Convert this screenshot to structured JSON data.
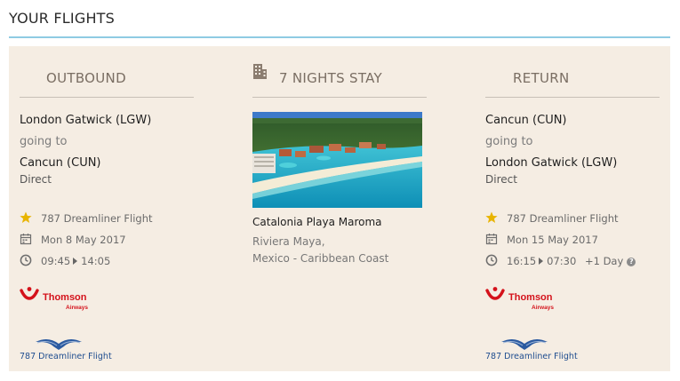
{
  "page": {
    "title": "YOUR FLIGHTS"
  },
  "outbound": {
    "heading": "OUTBOUND",
    "from": "London Gatwick (LGW)",
    "going_to": "going to",
    "to": "Cancun (CUN)",
    "direct": "Direct",
    "aircraft": "787 Dreamliner Flight",
    "date": "Mon 8 May 2017",
    "depart": "09:45",
    "arrive": "14:05",
    "airline_logo": {
      "brand": "Thomson",
      "sub": "Airways"
    },
    "dreamliner_logo": "787 Dreamliner Flight"
  },
  "stay": {
    "heading": "7 NIGHTS STAY",
    "hotel_name": "Catalonia Playa Maroma",
    "location_line1": "Riviera Maya,",
    "location_line2": "Mexico - Caribbean Coast"
  },
  "return": {
    "heading": "RETURN",
    "from": "Cancun (CUN)",
    "going_to": "going to",
    "to": "London Gatwick (LGW)",
    "direct": "Direct",
    "aircraft": "787 Dreamliner Flight",
    "date": "Mon 15 May 2017",
    "depart": "16:15",
    "arrive": "07:30",
    "plus_day": "+1 Day",
    "help_badge": "?",
    "airline_logo": {
      "brand": "Thomson",
      "sub": "Airways"
    },
    "dreamliner_logo": "787 Dreamliner Flight"
  },
  "colors": {
    "panel_bg": "#f5ede3",
    "title_rule": "#8fcbe3",
    "star": "#e8b400",
    "thomson_red": "#d4121b",
    "dreamliner_blue": "#1f4d8f"
  },
  "icons": {
    "aircraft": "star-icon",
    "date": "calendar-icon",
    "time": "clock-icon",
    "stay": "hotel-building-icon"
  }
}
